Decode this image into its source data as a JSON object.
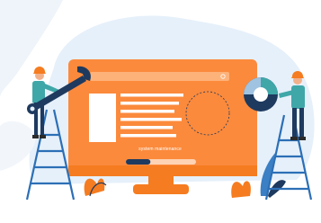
{
  "illustration": {
    "caption": "system maintenance",
    "maintenance_progress": 0.35,
    "colors": {
      "accent_orange": "#FB8A3C",
      "screen_orange": "#F57C20",
      "navy": "#1E3A5F",
      "teal": "#3FA7A8",
      "ladder_blue": "#2C6FB6",
      "backdrop_blue": "#E6F0FA"
    },
    "icons": [
      "wrench-icon",
      "search-icon",
      "magnifier-icon",
      "pie-chart-icon",
      "plant-icon",
      "ladder-icon",
      "worker-icon"
    ]
  }
}
